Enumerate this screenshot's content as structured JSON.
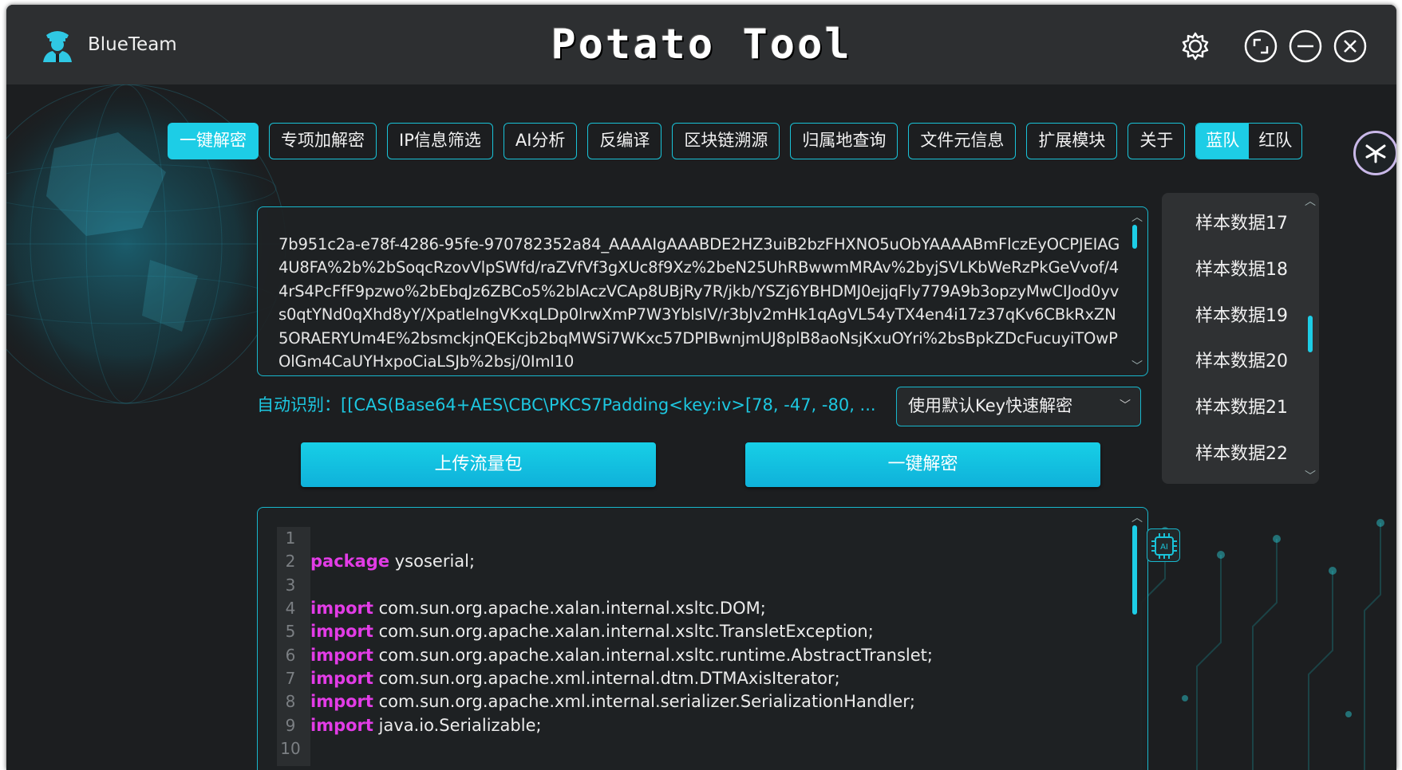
{
  "app": {
    "brand_name": "BlueTeam",
    "title": "Potato Tool"
  },
  "nav": {
    "tabs": [
      "一键解密",
      "专项加解密",
      "IP信息筛选",
      "AI分析",
      "反编译",
      "区块链溯源",
      "归属地查询",
      "文件元信息",
      "扩展模块",
      "关于"
    ],
    "active_index": 0,
    "team_options": [
      "蓝队",
      "红队"
    ],
    "team_active": "蓝队"
  },
  "input": {
    "text": "7b951c2a-e78f-4286-95fe-970782352a84_AAAAIgAAABDE2HZ3uiB2bzFHXNO5uObYAAAABmFlczEyOCPJEIAG4U8FA%2b%2bSoqcRzovVlpSWfd/raZVfVf3gXUc8f9Xz%2beN25UhRBwwmMRAv%2byjSVLKbWeRzPkGeVvof/44rS4PcFfF9pzwo%2bEbqJz6ZBCo5%2blAczVCAp8UBjRy7R/jkb/YSZj6YBHDMJ0ejjqFly779A9b3opzyMwCIJod0yvs0qtYNd0qXhd8yY/XpatleIngVKxqLDp0lrwXmP7W3YblsIV/r3bJv2mHk1qAgVL54yTX4en4i17z37qKv6CBkRxZN5ORAERYUm4E%2bsmckjnQEKcjb2bqMWSi7WKxc57DPIBwnjmUJ8plB8aoNsjKxuOYri%2bsBpkZDcFucuyiTOwPOlGm4CaUYHxpoCiaLSJb%2bsj/0Iml10"
  },
  "detect": {
    "label": "自动识别：[[CAS(Base64+AES\\CBC\\PKCS7Padding<key:iv>[78, -47, -80, ..."
  },
  "key_select": {
    "selected": "使用默认Key快速解密"
  },
  "buttons": {
    "upload": "上传流量包",
    "decrypt": "一键解密"
  },
  "samples": [
    "样本数据17",
    "样本数据18",
    "样本数据19",
    "样本数据20",
    "样本数据21",
    "样本数据22"
  ],
  "code": {
    "lines": [
      {
        "n": "1",
        "kw": "",
        "text": ""
      },
      {
        "n": "2",
        "kw": "package",
        "text": " ysoserial;"
      },
      {
        "n": "3",
        "kw": "",
        "text": ""
      },
      {
        "n": "4",
        "kw": "import",
        "text": " com.sun.org.apache.xalan.internal.xsltc.DOM;"
      },
      {
        "n": "5",
        "kw": "import",
        "text": " com.sun.org.apache.xalan.internal.xsltc.TransletException;"
      },
      {
        "n": "6",
        "kw": "import",
        "text": " com.sun.org.apache.xalan.internal.xsltc.runtime.AbstractTranslet;"
      },
      {
        "n": "7",
        "kw": "import",
        "text": " com.sun.org.apache.xml.internal.dtm.DTMAxisIterator;"
      },
      {
        "n": "8",
        "kw": "import",
        "text": " com.sun.org.apache.xml.internal.serializer.SerializationHandler;"
      },
      {
        "n": "9",
        "kw": "import",
        "text": " java.io.Serializable;"
      },
      {
        "n": "10",
        "kw": "",
        "text": ""
      }
    ]
  },
  "ai_badge": "AI",
  "colors": {
    "accent": "#1dcde6",
    "keyword": "#e23ce6",
    "detect_text": "#1dc7e0"
  }
}
